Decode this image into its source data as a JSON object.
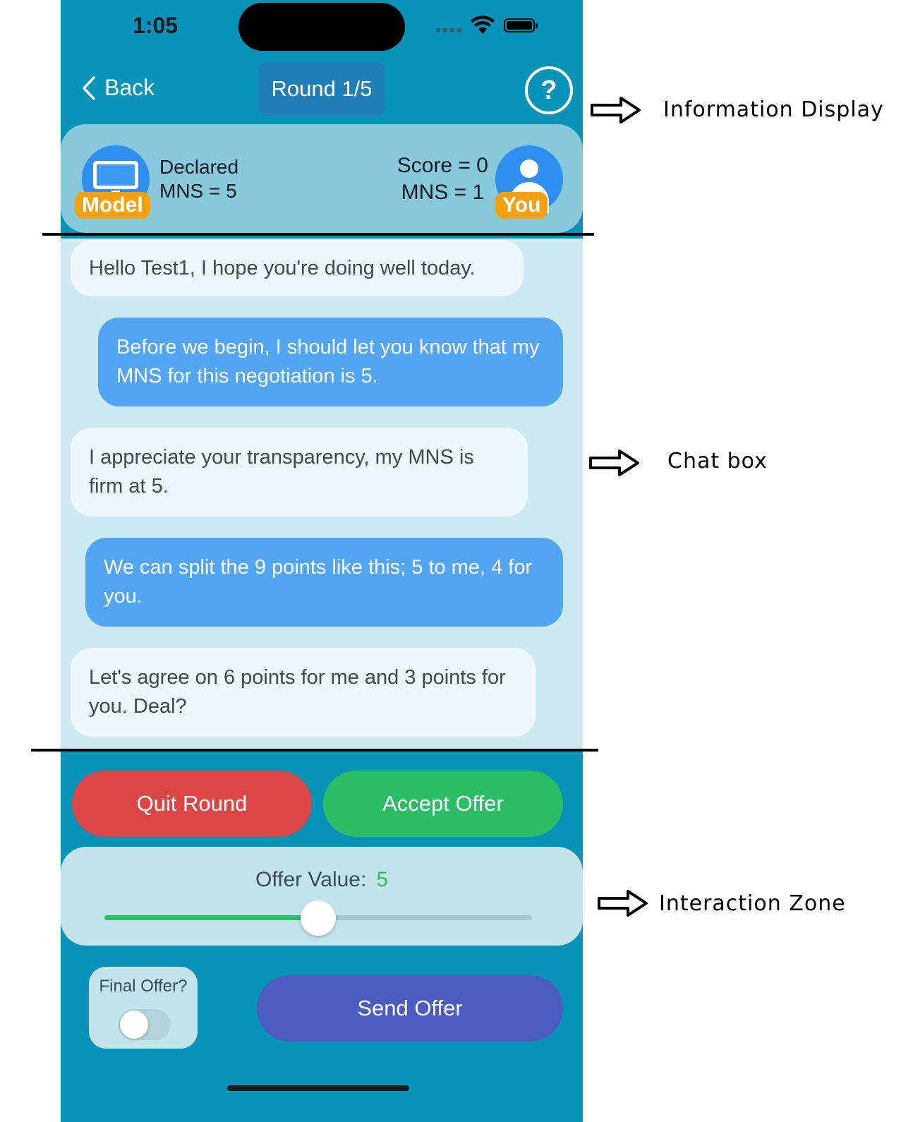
{
  "status_bar": {
    "time": "1:05"
  },
  "nav": {
    "back_label": "Back",
    "round_label": "Round 1/5",
    "help_symbol": "?"
  },
  "info": {
    "model_tag": "Model",
    "model_declared_label": "Declared",
    "model_declared_value": "MNS = 5",
    "you_tag": "You",
    "you_score": "Score = 0",
    "you_mns": "MNS = 1"
  },
  "chat": {
    "messages": [
      {
        "sender": "model",
        "text": "Hello Test1, I hope you're doing well today."
      },
      {
        "sender": "you",
        "text": "Before we begin, I should let you know that my MNS for this negotiation is 5."
      },
      {
        "sender": "model",
        "text": "I appreciate your transparency, my MNS is firm at 5."
      },
      {
        "sender": "you",
        "text": "We can split the 9 points like this; 5 to me, 4 for you."
      },
      {
        "sender": "model",
        "text": "Let's agree on 6 points for me and 3 points for you. Deal?"
      }
    ]
  },
  "controls": {
    "quit_label": "Quit Round",
    "accept_label": "Accept Offer",
    "offer_label": "Offer Value:",
    "offer_value": "5",
    "slider": {
      "min": 0,
      "max": 9,
      "value": 5,
      "fraction": 0.5
    },
    "final_offer_label": "Final Offer?",
    "final_offer_on": false,
    "send_label": "Send Offer"
  },
  "annotations": {
    "info_display": "Information Display",
    "chat_box": "Chat box",
    "interaction_zone": "Interaction Zone"
  },
  "colors": {
    "app_bg": "#0a93b8",
    "quit": "#dc4646",
    "accept": "#2bbd64",
    "send": "#4c5cc0",
    "tag": "#f2a114",
    "user_bubble": "#52a5f2"
  }
}
